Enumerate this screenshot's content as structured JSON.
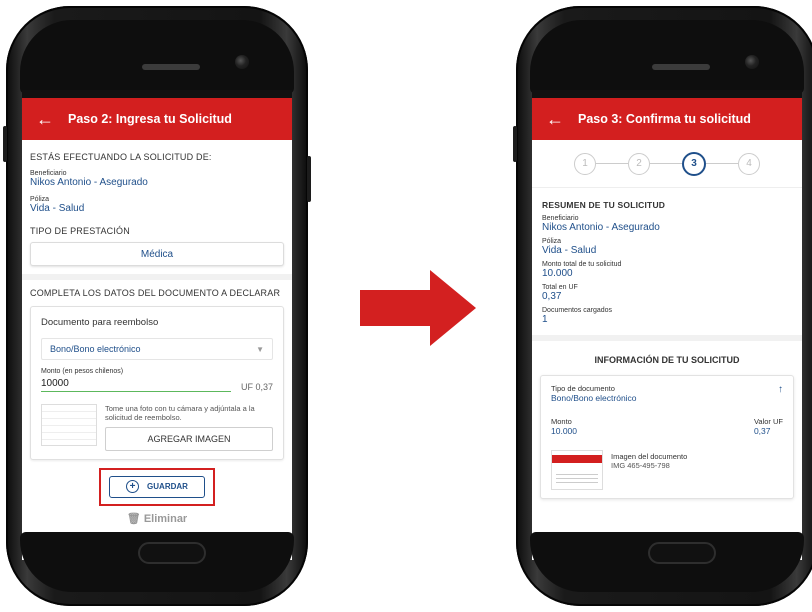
{
  "left_screen": {
    "header": {
      "back_icon": "arrow-left",
      "title": "Paso 2: Ingresa tu Solicitud"
    },
    "request_for_heading": "ESTÁS EFECTUANDO LA SOLICITUD DE:",
    "beneficiary_label": "Beneficiario",
    "beneficiary_value": "Nikos Antonio - Asegurado",
    "policy_label": "Póliza",
    "policy_value": "Vida - Salud",
    "service_type_label": "TIPO DE PRESTACIÓN",
    "service_type_value": "Médica",
    "complete_heading": "COMPLETA LOS DATOS DEL DOCUMENTO A DECLARAR",
    "document_card": {
      "title": "Documento para reembolso",
      "document_type_selected": "Bono/Bono electrónico",
      "amount_label": "Monto (en pesos chilenos)",
      "amount_value": "10000",
      "uf_value": "UF 0,37",
      "upload_hint": "Tome una foto con tu cámara y adjúntala a la solicitud de reembolso.",
      "add_image_label": "AGREGAR IMAGEN"
    },
    "save_label": "GUARDAR",
    "delete_label": "Eliminar"
  },
  "right_screen": {
    "header": {
      "back_icon": "arrow-left",
      "title": "Paso 3: Confirma tu solicitud"
    },
    "steps": [
      "1",
      "2",
      "3",
      "4"
    ],
    "active_step": "3",
    "summary_heading": "RESUMEN DE TU SOLICITUD",
    "beneficiary_label": "Beneficiario",
    "beneficiary_value": "Nikos Antonio - Asegurado",
    "policy_label": "Póliza",
    "policy_value": "Vida - Salud",
    "total_label": "Monto total de tu solicitud",
    "total_value": "10.000",
    "uf_total_label": "Total en UF",
    "uf_total_value": "0,37",
    "docs_loaded_label": "Documentos cargados",
    "docs_loaded_value": "1",
    "info_heading": "INFORMACIÓN DE TU SOLICITUD",
    "info_card": {
      "doc_type_label": "Tipo de documento",
      "doc_type_value": "Bono/Bono electrónico",
      "amount_label": "Monto",
      "amount_value": "10.000",
      "uf_label": "Valor UF",
      "uf_value": "0,37",
      "image_label": "Imagen del documento",
      "image_value": "IMG 465-495-798"
    }
  },
  "colors": {
    "brand_red": "#d31f1f",
    "link_blue": "#1f4f8a",
    "highlight_red": "#d32020",
    "valid_green": "#5cb85c"
  }
}
